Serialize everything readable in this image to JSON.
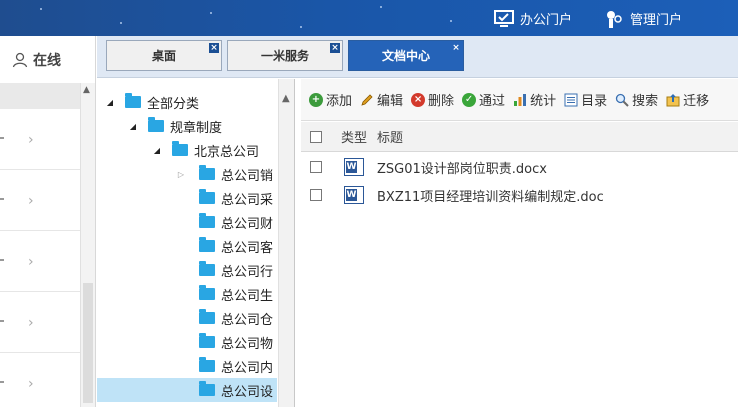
{
  "header": {
    "portals": [
      {
        "label": "办公门户",
        "icon": "monitor-check-icon"
      },
      {
        "label": "管理门户",
        "icon": "user-key-icon"
      }
    ]
  },
  "left_panel": {
    "online_label": "在线",
    "online_icon": "user-icon"
  },
  "tabs": [
    {
      "label": "桌面",
      "active": false
    },
    {
      "label": "一米服务",
      "active": false
    },
    {
      "label": "文档中心",
      "active": true
    }
  ],
  "tree": {
    "nodes": [
      {
        "label": "全部分类",
        "level": 0,
        "expanded": true
      },
      {
        "label": "规章制度",
        "level": 1,
        "expanded": true
      },
      {
        "label": "北京总公司",
        "level": 2,
        "expanded": true
      },
      {
        "label": "总公司销",
        "level": 3,
        "collapsed": true
      },
      {
        "label": "总公司采",
        "level": 3
      },
      {
        "label": "总公司财",
        "level": 3
      },
      {
        "label": "总公司客",
        "level": 3
      },
      {
        "label": "总公司行",
        "level": 3
      },
      {
        "label": "总公司生",
        "level": 3
      },
      {
        "label": "总公司仓",
        "level": 3
      },
      {
        "label": "总公司物",
        "level": 3
      },
      {
        "label": "总公司内",
        "level": 3
      },
      {
        "label": "总公司设",
        "level": 3,
        "selected": true
      }
    ]
  },
  "toolbar": {
    "items": [
      {
        "label": "添加",
        "icon": "add-icon",
        "color": "#3c9b3c"
      },
      {
        "label": "编辑",
        "icon": "pencil-icon",
        "color": "#e0a020"
      },
      {
        "label": "删除",
        "icon": "delete-icon",
        "color": "#d33a2c"
      },
      {
        "label": "通过",
        "icon": "check-icon",
        "color": "#3aa63a"
      },
      {
        "label": "统计",
        "icon": "bar-chart-icon",
        "color": "#e08a1e"
      },
      {
        "label": "目录",
        "icon": "list-icon",
        "color": "#3a6fb0"
      },
      {
        "label": "搜索",
        "icon": "search-icon",
        "color": "#3a6fb0"
      },
      {
        "label": "迁移",
        "icon": "move-icon",
        "color": "#e0a020"
      }
    ]
  },
  "table": {
    "headers": {
      "type": "类型",
      "title": "标题"
    },
    "rows": [
      {
        "icon": "word-doc-icon",
        "title": "ZSG01设计部岗位职责.docx"
      },
      {
        "icon": "word-doc-icon",
        "title": "BXZ11项目经理培训资料编制规定.doc"
      }
    ]
  }
}
